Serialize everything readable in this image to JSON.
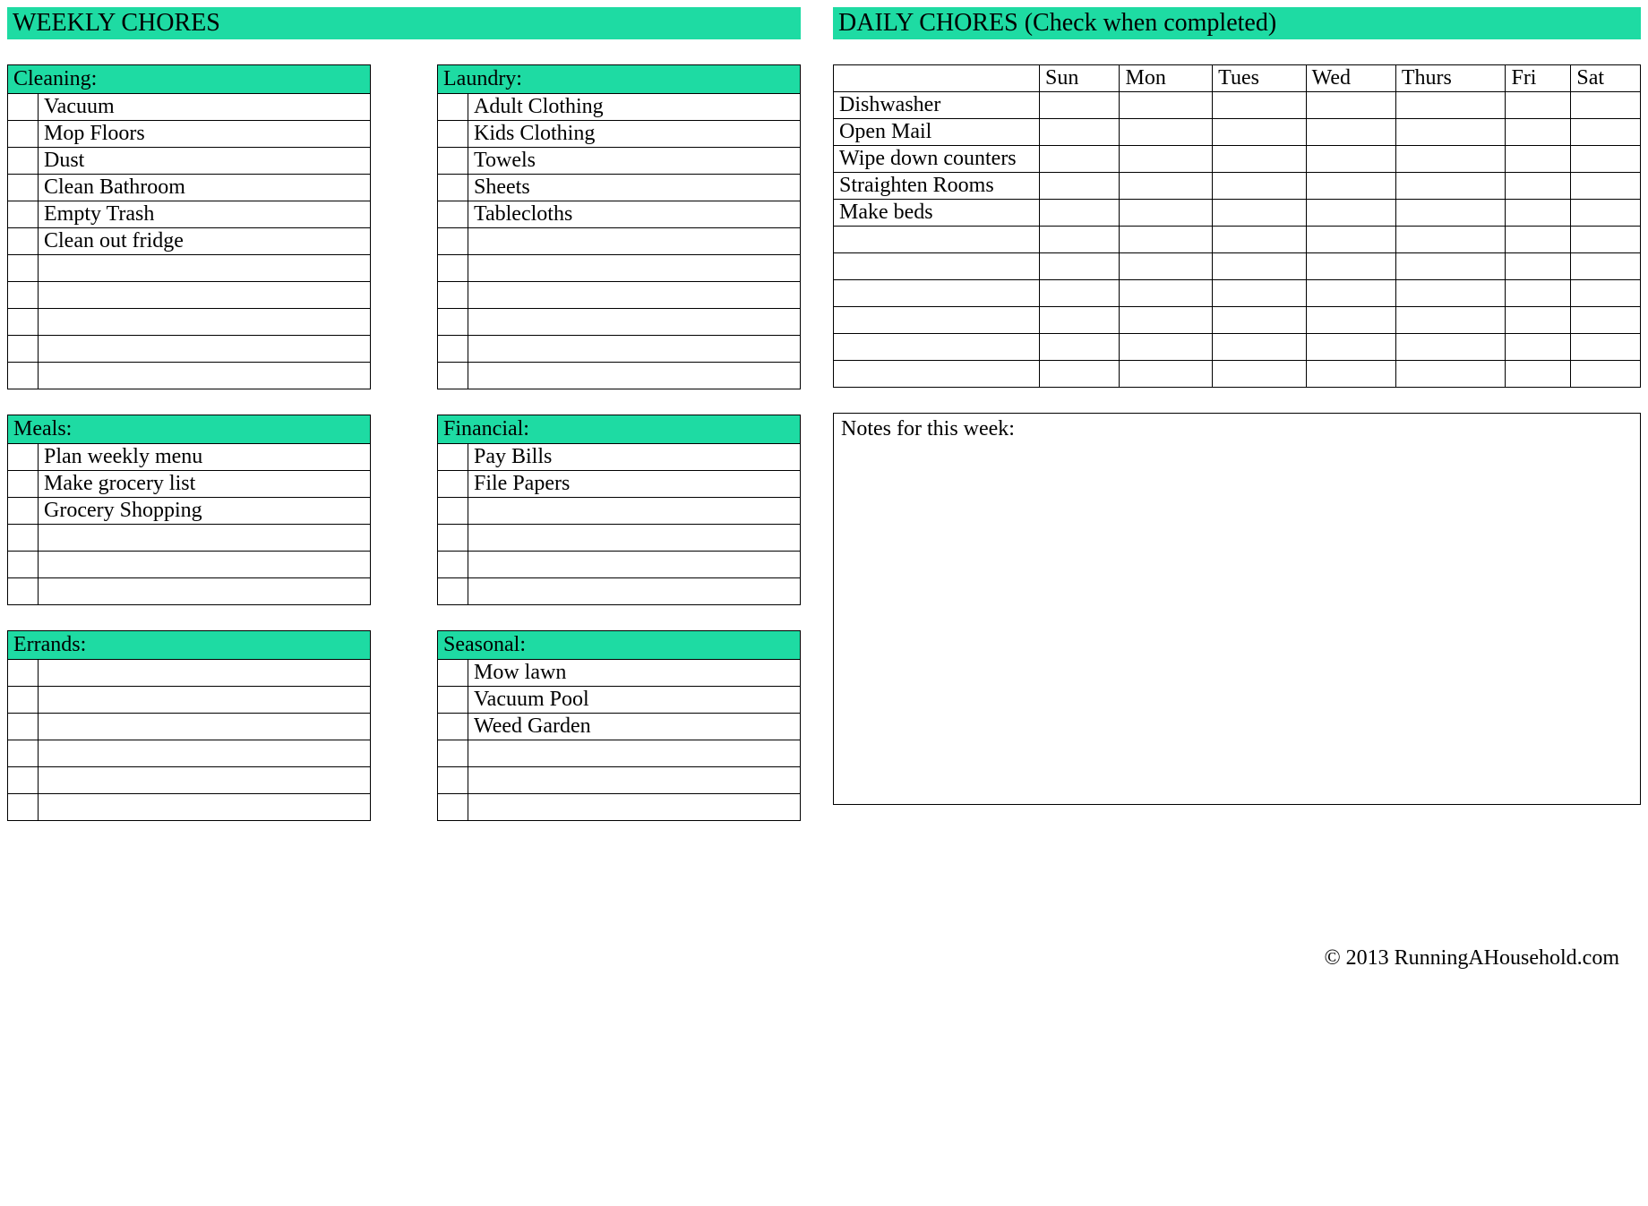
{
  "headers": {
    "weekly": "WEEKLY CHORES",
    "daily": "DAILY CHORES (Check when completed)"
  },
  "weekly": {
    "cleaning": {
      "title": "Cleaning:",
      "rows": 11,
      "items": [
        "Vacuum",
        "Mop Floors",
        "Dust",
        "Clean Bathroom",
        "Empty Trash",
        "Clean out fridge"
      ]
    },
    "laundry": {
      "title": "Laundry:",
      "rows": 11,
      "items": [
        "Adult Clothing",
        "Kids Clothing",
        "Towels",
        "Sheets",
        "Tablecloths"
      ]
    },
    "meals": {
      "title": "Meals:",
      "rows": 6,
      "items": [
        "Plan weekly menu",
        "Make grocery list",
        "Grocery Shopping"
      ]
    },
    "financial": {
      "title": "Financial:",
      "rows": 6,
      "items": [
        "Pay Bills",
        "File Papers"
      ]
    },
    "errands": {
      "title": "Errands:",
      "rows": 6,
      "items": []
    },
    "seasonal": {
      "title": "Seasonal:",
      "rows": 6,
      "items": [
        "Mow lawn",
        "Vacuum Pool",
        "Weed Garden"
      ]
    }
  },
  "daily": {
    "days": [
      "Sun",
      "Mon",
      "Tues",
      "Wed",
      "Thurs",
      "Fri",
      "Sat"
    ],
    "rows": 11,
    "tasks": [
      "Dishwasher",
      "Open Mail",
      "Wipe down counters",
      "Straighten Rooms",
      "Make beds"
    ]
  },
  "notes": {
    "title": "Notes for this week:"
  },
  "footer": "© 2013 RunningAHousehold.com"
}
